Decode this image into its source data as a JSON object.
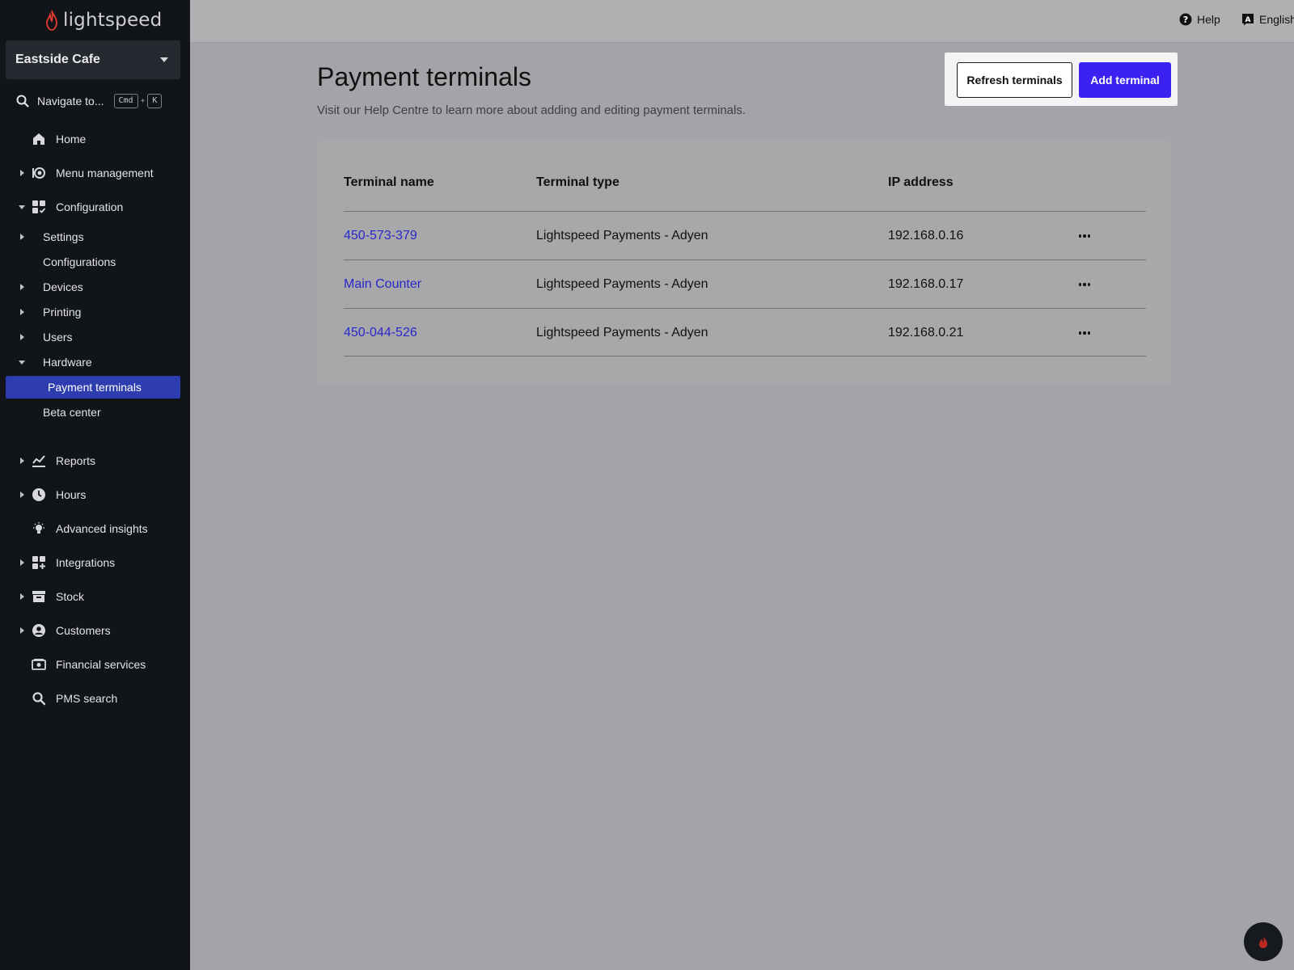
{
  "brand": {
    "logo_text": "lightspeed",
    "accent": "#e23b2e"
  },
  "sidebar": {
    "store_name": "Eastside Cafe",
    "navigate_label": "Navigate to...",
    "shortcut_keys": [
      "Cmd",
      "+",
      "K"
    ],
    "items": [
      {
        "label": "Home",
        "icon": "home-icon"
      },
      {
        "label": "Menu management",
        "icon": "menu-management-icon"
      },
      {
        "label": "Configuration",
        "icon": "configuration-icon"
      },
      {
        "label": "Reports",
        "icon": "reports-icon"
      },
      {
        "label": "Hours",
        "icon": "clock-icon"
      },
      {
        "label": "Advanced insights",
        "icon": "lightbulb-icon"
      },
      {
        "label": "Integrations",
        "icon": "integrations-icon"
      },
      {
        "label": "Stock",
        "icon": "stock-icon"
      },
      {
        "label": "Customers",
        "icon": "customer-icon"
      },
      {
        "label": "Financial services",
        "icon": "financial-services-icon"
      },
      {
        "label": "PMS search",
        "icon": "search-icon"
      }
    ],
    "config_subitems": [
      {
        "label": "Settings"
      },
      {
        "label": "Configurations"
      },
      {
        "label": "Devices"
      },
      {
        "label": "Printing"
      },
      {
        "label": "Users"
      },
      {
        "label": "Hardware"
      },
      {
        "label": "Payment terminals"
      },
      {
        "label": "Beta center"
      }
    ],
    "active_color": "#2d3db0"
  },
  "topbar": {
    "help_label": "Help",
    "language_label": "English"
  },
  "main": {
    "title": "Payment terminals",
    "subtitle": "Visit our Help Centre to learn more about adding and editing payment terminals.",
    "refresh_label": "Refresh terminals",
    "add_label": "Add terminal",
    "add_color": "#3b22f0"
  },
  "table": {
    "headers": [
      "Terminal name",
      "Terminal type",
      "IP address"
    ],
    "rows": [
      {
        "name": "450-573-379",
        "type": "Lightspeed Payments - Adyen",
        "ip": "192.168.0.16"
      },
      {
        "name": "Main Counter",
        "type": "Lightspeed Payments - Adyen",
        "ip": "192.168.0.17"
      },
      {
        "name": "450-044-526",
        "type": "Lightspeed Payments - Adyen",
        "ip": "192.168.0.21"
      }
    ]
  }
}
